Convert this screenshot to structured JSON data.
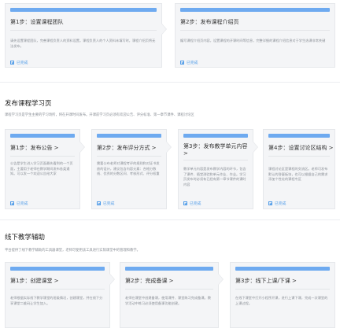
{
  "section1": {
    "cards": [
      {
        "title": "第1步：设置课程团队",
        "desc": "请先设置课程团队，完善课程负责人的资料设置。课程负责人的个人资料未填写时，课程介绍页将无法发布。",
        "status": "已完成"
      },
      {
        "title": "第2步：发布课程介绍页",
        "desc": "编写课程介绍页内容，设置课程的开课时间等信息，完整详细的课程介绍信息对于学生选课非常关键",
        "status": "已完成"
      }
    ]
  },
  "section2": {
    "title": "发布课程学习页",
    "desc": "课程学习页是学生主要的学习场所，将在开课时间发布。开课前学习页必须有欢迎公告、评分标准、第一章节课件、课程讨论区",
    "cards": [
      {
        "title": "第1步：发布公告 >",
        "desc": "公告是学生进入学习页面最先看到的一个页面，主要用于老师在教学期间发布各类通知。可以发一个欢迎公告给大家",
        "status": "已完成"
      },
      {
        "title": "第2步：发布评分方式 >",
        "desc": "需要公布老师对课程考评的规则和对证书发放的设计，建议包含内容元素：合格分数线、优秀的分数区间、考核形式、评分权重",
        "status": "已完成"
      },
      {
        "title": "第3步：发布教学单元内容 >",
        "desc": "教学单元内容是发布教学内容的环节，包含了课件、随堂测验和单元作业、作业。学习页发布时必须有已经有第一章节课件的课时内容",
        "status": "已完成"
      },
      {
        "title": "第4步：设置讨论区结构 >",
        "desc": "课程讨论区是课程的交流区。老师可发布默认的答疑板块，也可以根据自己的需求添加个性化的课程专区",
        "status": "已完成"
      }
    ]
  },
  "section3": {
    "title": "线下教学辅助",
    "desc": "平台提供了线下教学辅助的工具器课堂，老师可使用该工具进行实际课堂中的管理和教学。",
    "cards": [
      {
        "title": "第1步：创建课堂 >",
        "desc": "老师根据实际线下教学课堂的班级情况，创建课堂，并在线下分享课堂二维码让学生加入。",
        "status": ""
      },
      {
        "title": "第2步：完成备课 >",
        "desc": "老师在课堂中创建备课，使用课件、课堂练习完成备课。教学活动中练习必须使用备课功能创建。",
        "status": ""
      },
      {
        "title": "第3步：线下上课/下课 >",
        "desc": "在线下课堂中打开小程序开课，进行上课下课，完成一次课堂的上课过程。",
        "status": ""
      }
    ]
  }
}
